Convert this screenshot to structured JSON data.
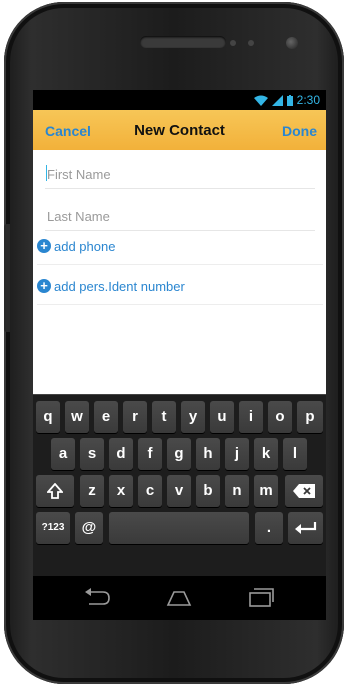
{
  "status": {
    "time": "2:30"
  },
  "header": {
    "cancel": "Cancel",
    "title": "New Contact",
    "done": "Done"
  },
  "form": {
    "first_name_placeholder": "First Name",
    "last_name_placeholder": "Last Name",
    "add_phone": "add phone",
    "add_ident": "add pers.Ident number"
  },
  "keyboard": {
    "row1": [
      "q",
      "w",
      "e",
      "r",
      "t",
      "y",
      "u",
      "i",
      "o",
      "p"
    ],
    "row2": [
      "a",
      "s",
      "d",
      "f",
      "g",
      "h",
      "j",
      "k",
      "l"
    ],
    "row3": [
      "z",
      "x",
      "c",
      "v",
      "b",
      "n",
      "m"
    ],
    "symbols": "?123",
    "at": "@",
    "dot": "."
  },
  "colors": {
    "accent": "#33b5e5",
    "header": "#f2b13a",
    "link": "#2a86d0"
  }
}
